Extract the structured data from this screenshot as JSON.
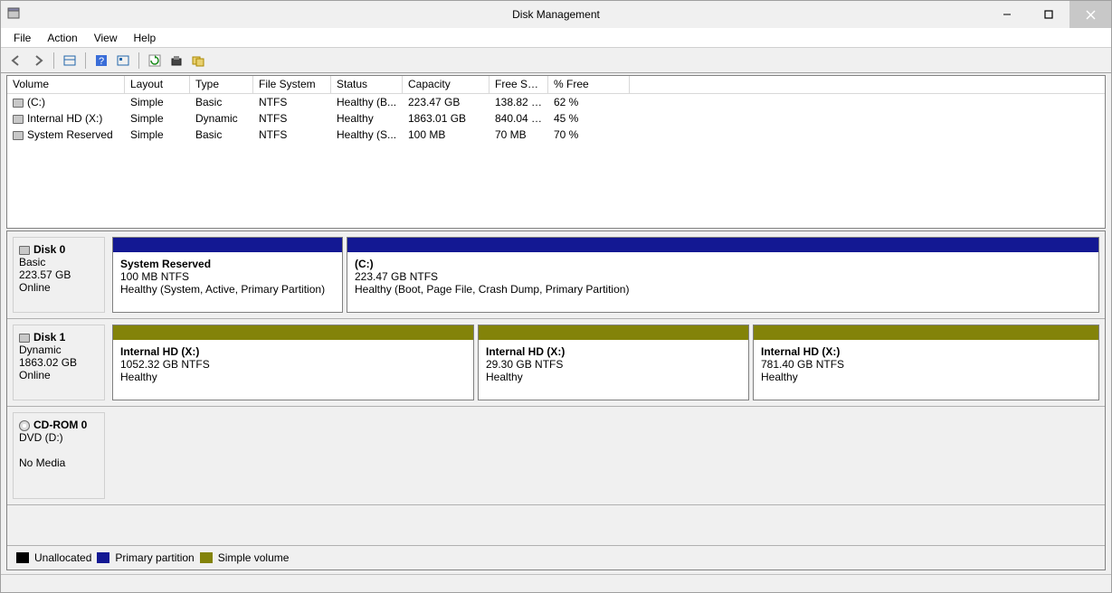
{
  "title": "Disk Management",
  "menu": {
    "file": "File",
    "action": "Action",
    "view": "View",
    "help": "Help"
  },
  "columns": {
    "volume": "Volume",
    "layout": "Layout",
    "type": "Type",
    "filesystem": "File System",
    "status": "Status",
    "capacity": "Capacity",
    "free": "Free Spa...",
    "pctfree": "% Free"
  },
  "volumes": [
    {
      "name": "(C:)",
      "layout": "Simple",
      "type": "Basic",
      "fs": "NTFS",
      "status": "Healthy (B...",
      "capacity": "223.47 GB",
      "free": "138.82 GB",
      "pct": "62 %"
    },
    {
      "name": "Internal HD (X:)",
      "layout": "Simple",
      "type": "Dynamic",
      "fs": "NTFS",
      "status": "Healthy",
      "capacity": "1863.01 GB",
      "free": "840.04 GB",
      "pct": "45 %"
    },
    {
      "name": "System Reserved",
      "layout": "Simple",
      "type": "Basic",
      "fs": "NTFS",
      "status": "Healthy (S...",
      "capacity": "100 MB",
      "free": "70 MB",
      "pct": "70 %"
    }
  ],
  "disks": [
    {
      "name": "Disk 0",
      "type": "Basic",
      "size": "223.57 GB",
      "state": "Online",
      "partitions": [
        {
          "title": "System Reserved",
          "sub": "100 MB NTFS",
          "status": "Healthy (System, Active, Primary Partition)",
          "color": "navy",
          "flex": "0 0 255px"
        },
        {
          "title": " (C:)",
          "sub": "223.47 GB NTFS",
          "status": "Healthy (Boot, Page File, Crash Dump, Primary Partition)",
          "color": "navy",
          "flex": "1"
        }
      ]
    },
    {
      "name": "Disk 1",
      "type": "Dynamic",
      "size": "1863.02 GB",
      "state": "Online",
      "partitions": [
        {
          "title": "Internal HD  (X:)",
          "sub": "1052.32 GB NTFS",
          "status": "Healthy",
          "color": "olive",
          "flex": "0 0 400px"
        },
        {
          "title": "Internal HD  (X:)",
          "sub": "29.30 GB NTFS",
          "status": "Healthy",
          "color": "olive",
          "flex": "0 0 300px"
        },
        {
          "title": "Internal HD  (X:)",
          "sub": "781.40 GB NTFS",
          "status": "Healthy",
          "color": "olive",
          "flex": "1"
        }
      ]
    },
    {
      "name": "CD-ROM 0",
      "type": "DVD (D:)",
      "size": "",
      "state": "No Media",
      "cd": true,
      "partitions": []
    }
  ],
  "legend": {
    "unallocated": "Unallocated",
    "primary": "Primary partition",
    "simple": "Simple volume"
  }
}
